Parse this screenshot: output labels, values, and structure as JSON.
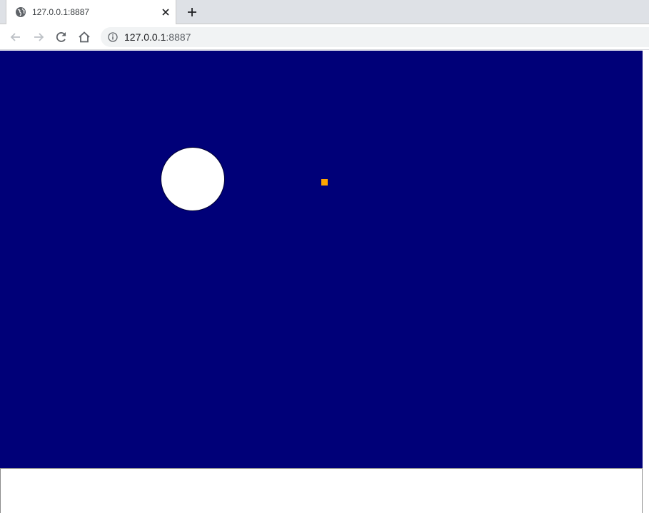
{
  "browser": {
    "tab": {
      "title": "127.0.0.1:8887",
      "favicon": "globe-icon",
      "close_icon": "close-icon"
    },
    "new_tab_icon": "plus-icon",
    "toolbar": {
      "back_icon": "back-arrow-icon",
      "forward_icon": "forward-arrow-icon",
      "reload_icon": "reload-icon",
      "home_icon": "home-icon",
      "info_icon": "info-icon",
      "url_host": "127.0.0.1",
      "url_port": ":8887"
    }
  },
  "game": {
    "background_color": "#000078",
    "ball_color": "#ffffff",
    "pellet_color": "#ffa500"
  }
}
